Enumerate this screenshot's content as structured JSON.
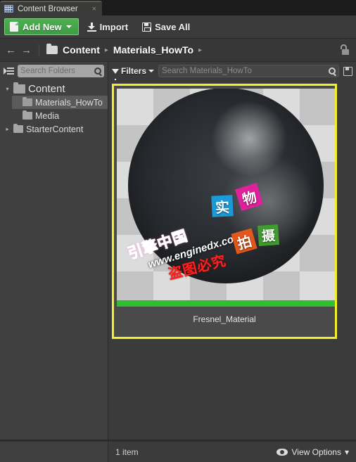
{
  "window": {
    "tab_title": "Content Browser",
    "tab_icon": "content-browser-icon",
    "close_label": "×"
  },
  "toolbar": {
    "add_new_label": "Add New",
    "add_new_icon": "new-document-icon",
    "add_new_color": "#43a047",
    "import_label": "Import",
    "import_icon": "import-arrow-icon",
    "save_all_label": "Save All",
    "save_all_icon": "floppy-disk-icon"
  },
  "breadcrumb": {
    "back_label": "←",
    "forward_label": "→",
    "folder_icon": "folder-icon",
    "items": [
      "Content",
      "Materials_HowTo"
    ],
    "separator": "▸",
    "lock_icon": "unlocked-padlock-icon"
  },
  "sidebar": {
    "filter_icon": "folder-filter-icon",
    "search_placeholder": "Search Folders",
    "search_value": "",
    "search_icon": "magnifier-icon",
    "tree": [
      {
        "label": "Content",
        "level": 0,
        "expanded": true,
        "selected": false,
        "has_children": true
      },
      {
        "label": "Materials_HowTo",
        "level": 1,
        "expanded": false,
        "selected": true,
        "has_children": false
      },
      {
        "label": "Media",
        "level": 1,
        "expanded": false,
        "selected": false,
        "has_children": false
      },
      {
        "label": "StarterContent",
        "level": 1,
        "expanded": false,
        "selected": false,
        "has_children": true
      }
    ]
  },
  "asset_panel": {
    "filters_label": "Filters",
    "filters_icon": "funnel-icon",
    "search_placeholder": "Search Materials_HowTo",
    "search_value": "",
    "search_icon": "magnifier-icon",
    "save_icon": "floppy-disk-icon",
    "selection_color": "#f2f02a",
    "assets": [
      {
        "name": "Fresnel_Material",
        "selected": true,
        "type_bar_color": "#2fbf2f",
        "thumbnail": "dark-glossy-sphere-on-checkerboard"
      }
    ]
  },
  "watermarks": {
    "brand": "引擎中国",
    "url": "www.enginedx.com",
    "warning": "盗图必究",
    "chips": [
      {
        "text": "实",
        "color": "#1a9bd7"
      },
      {
        "text": "物",
        "color": "#e0219b"
      },
      {
        "text": "拍",
        "color": "#e2571c"
      },
      {
        "text": "摄",
        "color": "#3f9c2f"
      }
    ]
  },
  "status_bar": {
    "item_count": "1 item",
    "view_options_label": "View Options",
    "view_options_icon": "eye-icon",
    "view_options_caret": "▾"
  }
}
